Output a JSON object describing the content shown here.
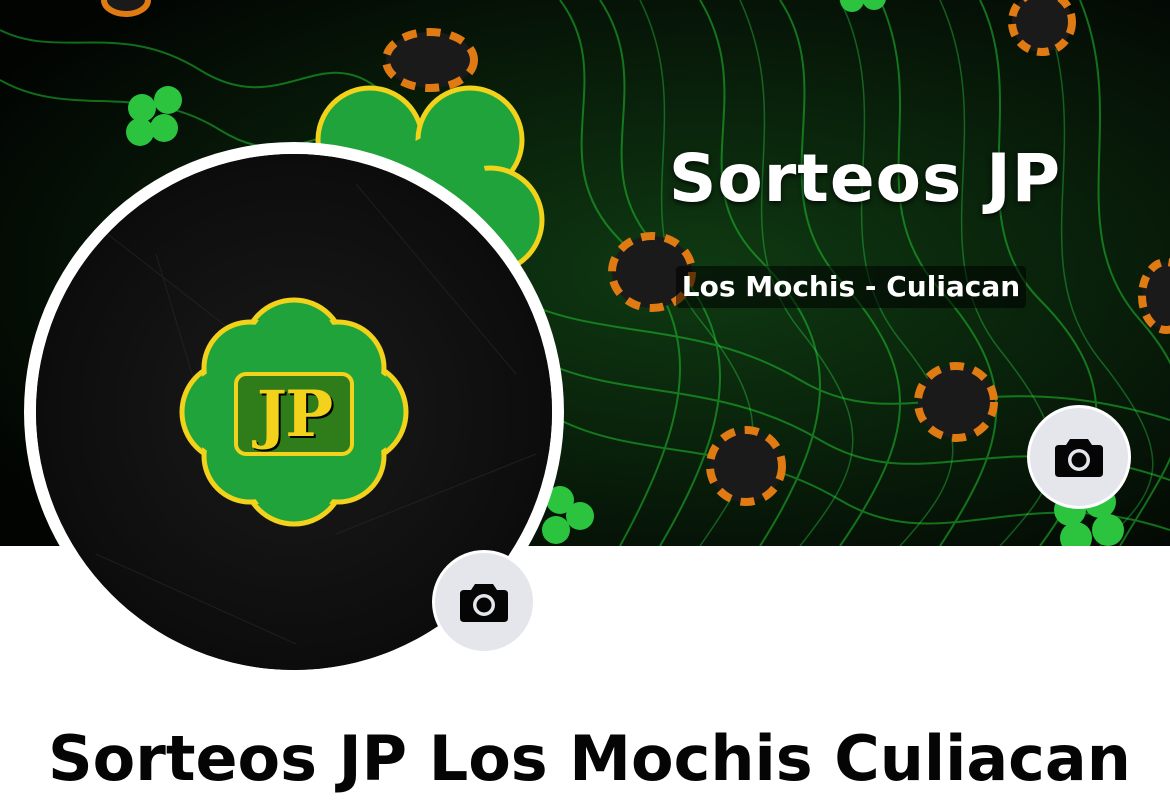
{
  "cover": {
    "title": "Sorteos JP",
    "subtitle": "Los Mochis - Culiacan"
  },
  "profile": {
    "logo_text": "JP"
  },
  "page": {
    "name": "Sorteos JP Los Mochis Culiacan"
  },
  "icons": {
    "cover_camera": "camera-icon",
    "profile_camera": "camera-icon"
  },
  "colors": {
    "clover_green": "#1fa33a",
    "clover_outline": "#f2d21b",
    "chip_orange": "#e07a12",
    "camera_button_bg": "#e4e6eb",
    "name_text": "#050505"
  }
}
